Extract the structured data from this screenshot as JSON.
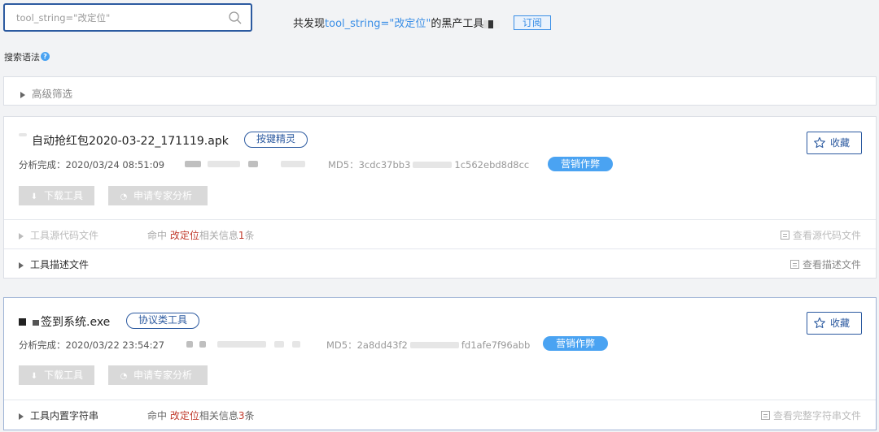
{
  "search": {
    "placeholder": "tool_string=\"改定位\""
  },
  "result": {
    "prefix": "共发现",
    "keyword": "tool_string=\"改定位\"",
    "suffix": "的黑产工具"
  },
  "subscribe_label": "订阅",
  "syntax_label": "搜索语法",
  "syntax_help": "?",
  "advanced_filter_label": "高级筛选",
  "cards": [
    {
      "name": "自动抢红包2020-03-22_171119.apk",
      "tag": "按键精灵",
      "analysis": "分析完成：2020/03/24 08:51:09",
      "md5_prefix": "MD5：3cdc37bb3",
      "md5_suffix": "1c562ebd8d8cc",
      "category": "营销作弊",
      "download_label": "下载工具",
      "expert_label": "申请专家分析",
      "favorite_label": "收藏",
      "rows": [
        {
          "label": "工具源代码文件",
          "hit_prefix": "命中 ",
          "hit_key": "改定位",
          "hit_middle": "相关信息",
          "hit_count": "1",
          "hit_suffix": "条",
          "link": "查看源代码文件"
        },
        {
          "label": "工具描述文件",
          "link": "查看描述文件"
        }
      ]
    },
    {
      "name": "签到系统.exe",
      "tag": "协议类工具",
      "analysis": "分析完成：2020/03/22 23:54:27",
      "md5_prefix": "MD5：2a8dd43f2",
      "md5_suffix": "fd1afe7f96abb",
      "category": "营销作弊",
      "download_label": "下载工具",
      "expert_label": "申请专家分析",
      "favorite_label": "收藏",
      "rows": [
        {
          "label": "工具内置字符串",
          "hit_prefix": "命中 ",
          "hit_key": "改定位",
          "hit_middle": "相关信息",
          "hit_count": "3",
          "hit_suffix": "条",
          "link": "查看完整字符串文件"
        }
      ]
    }
  ],
  "colors": {
    "accent": "#2c5aa0",
    "link_blue": "#3a8ee6",
    "tag_blue": "#4aa3f2",
    "hit_red": "#c0392b"
  }
}
